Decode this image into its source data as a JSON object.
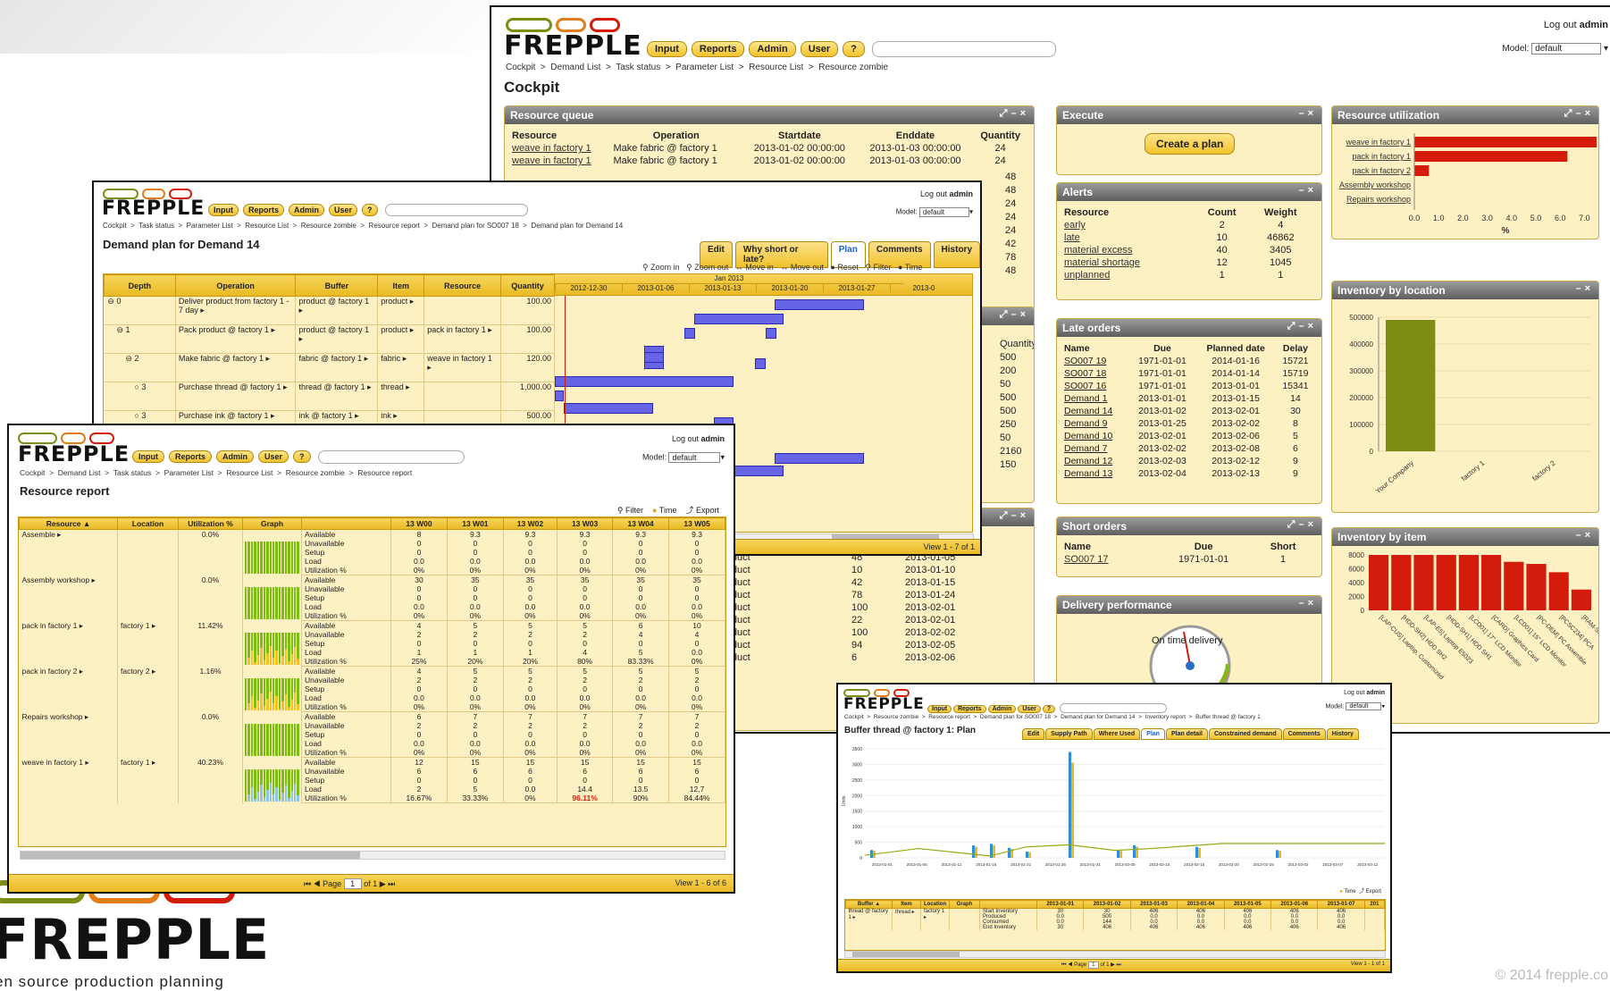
{
  "brand": {
    "name": "FREPPLE",
    "tagline": "en source production planning",
    "copyright": "© 2014 frepple.co"
  },
  "menu": [
    "Input",
    "Reports",
    "Admin",
    "User",
    "?"
  ],
  "colors": {
    "accent": "#f2c22b",
    "bar": "#6565e6",
    "red": "#d41c0c",
    "olive": "#7d8c12",
    "green": "#7dbe12"
  },
  "cockpit": {
    "logout_text": "Log out",
    "user": "admin",
    "model_label": "Model:",
    "model_value": "default",
    "breadcrumbs": "Cockpit  >  Demand List  >  Task status  >  Parameter List  >  Resource List  >  Resource zombie",
    "title": "Cockpit",
    "resource_queue": {
      "title": "Resource queue",
      "headers": [
        "Resource",
        "Operation",
        "Startdate",
        "Enddate",
        "Quantity"
      ],
      "rows": [
        [
          "weave in factory 1",
          "Make fabric @ factory 1",
          "2013-01-02 00:00:00",
          "2013-01-03 00:00:00",
          "24"
        ],
        [
          "weave in factory 1",
          "Make fabric @ factory 1",
          "2013-01-02 00:00:00",
          "2013-01-03 00:00:00",
          "24"
        ]
      ],
      "extra_qty": [
        "48",
        "48",
        "24",
        "24",
        "24",
        "42",
        "78",
        "48"
      ]
    },
    "hidden_widget": {
      "quantity_label": "Quantity",
      "quantities": [
        "500",
        "200",
        "50",
        "500",
        "500",
        "250",
        "50",
        "2160",
        "150"
      ]
    },
    "hidden_orders": {
      "plan_date_label": "Plan date",
      "rows": [
        [
          "product",
          "",
          "2013-01-01"
        ],
        [
          "product",
          "48",
          "2013-01-05"
        ],
        [
          "product",
          "10",
          "2013-01-10"
        ],
        [
          "product",
          "42",
          "2013-01-15"
        ],
        [
          "product",
          "78",
          "2013-01-24"
        ],
        [
          "product",
          "100",
          "2013-02-01"
        ],
        [
          "product",
          "22",
          "2013-02-01"
        ],
        [
          "product",
          "100",
          "2013-02-02"
        ],
        [
          "product",
          "94",
          "2013-02-05"
        ],
        [
          "product",
          "6",
          "2013-02-06"
        ]
      ]
    },
    "execute": {
      "title": "Execute",
      "button": "Create a plan"
    },
    "alerts": {
      "title": "Alerts",
      "headers": [
        "Resource",
        "Count",
        "Weight"
      ],
      "rows": [
        [
          "early",
          "2",
          "4"
        ],
        [
          "late",
          "10",
          "46862"
        ],
        [
          "material excess",
          "40",
          "3405"
        ],
        [
          "material shortage",
          "12",
          "1045"
        ],
        [
          "unplanned",
          "1",
          "1"
        ]
      ]
    },
    "late_orders": {
      "title": "Late orders",
      "headers": [
        "Name",
        "Due",
        "Planned date",
        "Delay"
      ],
      "rows": [
        [
          "SO007 19",
          "1971-01-01",
          "2014-01-16",
          "15721"
        ],
        [
          "SO007 18",
          "1971-01-01",
          "2014-01-14",
          "15719"
        ],
        [
          "SO007 16",
          "1971-01-01",
          "2013-01-01",
          "15341"
        ],
        [
          "Demand 1",
          "2013-01-01",
          "2013-01-15",
          "14"
        ],
        [
          "Demand 14",
          "2013-01-02",
          "2013-02-01",
          "30"
        ],
        [
          "Demand 9",
          "2013-01-25",
          "2013-02-02",
          "8"
        ],
        [
          "Demand 10",
          "2013-02-01",
          "2013-02-06",
          "5"
        ],
        [
          "Demand 7",
          "2013-02-02",
          "2013-02-08",
          "6"
        ],
        [
          "Demand 12",
          "2013-02-03",
          "2013-02-12",
          "9"
        ],
        [
          "Demand 13",
          "2013-02-04",
          "2013-02-13",
          "9"
        ]
      ]
    },
    "short_orders": {
      "title": "Short orders",
      "headers": [
        "Name",
        "Due",
        "Short"
      ],
      "rows": [
        [
          "SO007 17",
          "1971-01-01",
          "1"
        ]
      ]
    },
    "delivery": {
      "title": "Delivery performance",
      "gauge_label": "On time delivery"
    },
    "resource_utilization": {
      "title": "Resource utilization",
      "unit": "%",
      "ticks": [
        "0.0",
        "1.0",
        "2.0",
        "3.0",
        "4.0",
        "5.0",
        "6.0",
        "7.0"
      ]
    },
    "inventory_location": {
      "title": "Inventory by location",
      "ticks": [
        "500000",
        "400000",
        "300000",
        "200000",
        "100000",
        "0"
      ]
    },
    "inventory_item": {
      "title": "Inventory by item",
      "ticks": [
        "8000",
        "6000",
        "4000",
        "2000",
        "0"
      ],
      "labels": [
        "[LAP-CUS] Laptop, Customized",
        "[HDD-SH2] HDD SH2",
        "[LAP-E5] Laptop E5023",
        "[HDD-SH1] HDD SH1",
        "[LCD01] 17\" LCD Monitor",
        "[CARD] Graphics Card",
        "[LCD01] 15\" LCD Monitor",
        "[PC-DEM] PC Assemble",
        "[PCSC234] PCA",
        "[RAM-SR5]"
      ]
    }
  },
  "chart_data": [
    {
      "type": "bar",
      "title": "Resource utilization",
      "categories": [
        "weave in factory 1",
        "pack in factory 1",
        "pack in factory 2",
        "Assembly workshop",
        "Repairs workshop"
      ],
      "values": [
        7.5,
        6.3,
        0.6,
        0,
        0
      ],
      "xlabel": "%",
      "xlim": [
        0,
        7.5
      ]
    },
    {
      "type": "bar",
      "title": "Inventory by location",
      "categories": [
        "Your Company",
        "factory 1",
        "factory 2"
      ],
      "values": [
        490000,
        0,
        0
      ],
      "ylim": [
        0,
        500000
      ]
    },
    {
      "type": "bar",
      "title": "Inventory by item",
      "categories": [
        "[LAP-CUS] Laptop, Customized",
        "[HDD-SH2] HDD SH2",
        "[LAP-E5] Laptop E5023",
        "[HDD-SH1] HDD SH1",
        "[LCD01] 17\" LCD Monitor",
        "[CARD] Graphics Card",
        "[LCD01] 15\" LCD Monitor",
        "[PC-DEM] PC Assemble",
        "[PCSC234] PCA",
        "[RAM-SR5]"
      ],
      "values": [
        8000,
        8000,
        8000,
        8000,
        8000,
        8000,
        7000,
        6700,
        5500,
        3000
      ],
      "ylim": [
        0,
        8000
      ]
    }
  ],
  "demand_plan": {
    "logout_text": "Log out",
    "user": "admin",
    "model_label": "Model:",
    "model_value": "default",
    "breadcrumbs": "Cockpit  >  Task status  >  Parameter List  >  Resource List  >  Resource zombie  >  Resource report  >  Demand plan for SO007 18  >  Demand plan for Demand 14",
    "title": "Demand plan for Demand 14",
    "tabs": [
      "Edit",
      "Why short or late?",
      "Plan",
      "Comments",
      "History"
    ],
    "active_tab": "Plan",
    "tools": [
      "Zoom in",
      "Zoom out",
      "Move in",
      "Move out",
      "Reset",
      "Filter",
      "Time"
    ],
    "headers": [
      "Depth",
      "Operation",
      "Buffer",
      "Item",
      "Resource",
      "Quantity"
    ],
    "month": "Jan 2013",
    "dates": [
      "2012-12-30",
      "2013-01-06",
      "2013-01-13",
      "2013-01-20",
      "2013-01-27",
      "2013-0"
    ],
    "rows": [
      {
        "depth": "0",
        "operation": "Deliver product from factory 1 - 7 day",
        "buffer": "product @ factory 1",
        "item": "product",
        "resource": "",
        "qty": "100.00"
      },
      {
        "depth": "1",
        "operation": "Pack product @ factory 1",
        "buffer": "product @ factory 1",
        "item": "product",
        "resource": "pack in factory 1",
        "qty": "100.00"
      },
      {
        "depth": "2",
        "operation": "Make fabric @ factory 1",
        "buffer": "fabric @ factory 1",
        "item": "fabric",
        "resource": "weave in factory 1",
        "qty": "120.00"
      },
      {
        "depth": "3",
        "operation": "Purchase thread @ factory 1",
        "buffer": "thread @ factory 1",
        "item": "thread",
        "resource": "",
        "qty": "1,000.00"
      },
      {
        "depth": "3",
        "operation": "Purchase ink @ factory 1",
        "buffer": "ink @ factory 1",
        "item": "ink",
        "resource": "",
        "qty": "500.00"
      }
    ],
    "footer": "View 1 - 7 of 1"
  },
  "resource_report": {
    "logout_text": "Log out",
    "user": "admin",
    "model_label": "Model:",
    "model_value": "default",
    "breadcrumbs": "Cockpit  >  Demand List  >  Task status  >  Parameter List  >  Resource List  >  Resource zombie  >  Resource report",
    "title": "Resource report",
    "tools": [
      "Filter",
      "Time",
      "Export"
    ],
    "headers": [
      "Resource ▲",
      "Location",
      "Utilization %",
      "Graph",
      "",
      "13 W00",
      "13 W01",
      "13 W02",
      "13 W03",
      "13 W04",
      "13 W05"
    ],
    "measures": [
      "Available",
      "Unavailable",
      "Setup",
      "Load",
      "Utilization %"
    ],
    "resources": [
      {
        "name": "Assemble",
        "location": "",
        "util": "0.0%",
        "values": [
          [
            "8",
            "9.3",
            "9.3",
            "9.3",
            "9.3",
            "9.3"
          ],
          [
            "0",
            "0",
            "0",
            "0",
            "0",
            "0"
          ],
          [
            "0",
            "0",
            "0",
            "0",
            "0",
            "0"
          ],
          [
            "0.0",
            "0.0",
            "0.0",
            "0.0",
            "0.0",
            "0.0"
          ],
          [
            "0%",
            "0%",
            "0%",
            "0%",
            "0%",
            "0%"
          ]
        ]
      },
      {
        "name": "Assembly workshop",
        "location": "",
        "util": "0.0%",
        "values": [
          [
            "30",
            "35",
            "35",
            "35",
            "35",
            "35"
          ],
          [
            "0",
            "0",
            "0",
            "0",
            "0",
            "0"
          ],
          [
            "0",
            "0",
            "0",
            "0",
            "0",
            "0"
          ],
          [
            "0.0",
            "0.0",
            "0.0",
            "0.0",
            "0.0",
            "0.0"
          ],
          [
            "0%",
            "0%",
            "0%",
            "0%",
            "0%",
            "0%"
          ]
        ]
      },
      {
        "name": "pack in factory 1",
        "location": "factory 1",
        "util": "11.42%",
        "values": [
          [
            "4",
            "5",
            "5",
            "5",
            "6",
            "10"
          ],
          [
            "2",
            "2",
            "2",
            "2",
            "4",
            "4"
          ],
          [
            "0",
            "0",
            "0",
            "0",
            "0",
            "0"
          ],
          [
            "1",
            "1",
            "1",
            "4",
            "5",
            "0.0"
          ],
          [
            "25%",
            "20%",
            "20%",
            "80%",
            "83.33%",
            "0%"
          ]
        ]
      },
      {
        "name": "pack in factory 2",
        "location": "factory 2",
        "util": "1.16%",
        "values": [
          [
            "4",
            "5",
            "5",
            "5",
            "5",
            "5"
          ],
          [
            "2",
            "2",
            "2",
            "2",
            "2",
            "2"
          ],
          [
            "0",
            "0",
            "0",
            "0",
            "0",
            "0"
          ],
          [
            "0.0",
            "0.0",
            "0.0",
            "0.0",
            "0.0",
            "0.0"
          ],
          [
            "0%",
            "0%",
            "0%",
            "0%",
            "0%",
            "0%"
          ]
        ]
      },
      {
        "name": "Repairs workshop",
        "location": "",
        "util": "0.0%",
        "values": [
          [
            "6",
            "7",
            "7",
            "7",
            "7",
            "7"
          ],
          [
            "2",
            "2",
            "2",
            "2",
            "2",
            "2"
          ],
          [
            "0",
            "0",
            "0",
            "0",
            "0",
            "0"
          ],
          [
            "0.0",
            "0.0",
            "0.0",
            "0.0",
            "0.0",
            "0.0"
          ],
          [
            "0%",
            "0%",
            "0%",
            "0%",
            "0%",
            "0%"
          ]
        ]
      },
      {
        "name": "weave in factory 1",
        "location": "factory 1",
        "util": "40.23%",
        "values": [
          [
            "12",
            "15",
            "15",
            "15",
            "15",
            "15"
          ],
          [
            "6",
            "6",
            "6",
            "6",
            "6",
            "6"
          ],
          [
            "0",
            "0",
            "0",
            "0",
            "0",
            "0"
          ],
          [
            "2",
            "5",
            "0.0",
            "14.4",
            "13.5",
            "12.7"
          ],
          [
            "16.67%",
            "33.33%",
            "0%",
            "96.11%",
            "90%",
            "84.44%"
          ]
        ]
      }
    ],
    "page_label": "Page",
    "page": "1",
    "of_label": "of 1",
    "footer": "View 1 - 6 of 6"
  },
  "buffer_plan": {
    "logout_text": "Log out",
    "user": "admin",
    "model_label": "Model:",
    "model_value": "default",
    "breadcrumbs": "Cockpit  >  Resource zombie  >  Resource report  >  Demand plan for SO007 18  >  Demand plan for Demand 14  >  Inventory report  >  Buffer thread @ factory 1",
    "title": "Buffer thread @ factory 1: Plan",
    "tabs": [
      "Edit",
      "Supply Path",
      "Where Used",
      "Plan",
      "Plan detail",
      "Constrained demand",
      "Comments",
      "History"
    ],
    "active_tab": "Plan",
    "yticks": [
      "3500",
      "3000",
      "2500",
      "2000",
      "1500",
      "1000",
      "500",
      "0"
    ],
    "ylabel": "Units",
    "xdates": [
      "2013-01-01",
      "2013-01-06",
      "2013-01-11",
      "2013-01-16",
      "2013-01-21",
      "2013-01-26",
      "2013-01-31",
      "2013-02-05",
      "2013-02-10",
      "2013-02-15",
      "2013-02-20",
      "2013-02-25",
      "2013-03-02",
      "2013-03-07",
      "2013-03-12"
    ],
    "legend": [
      "Time",
      "Export"
    ],
    "headers": [
      "Buffer ▲",
      "Item",
      "Location",
      "Graph",
      "",
      "2013-01-01",
      "2013-01-02",
      "2013-01-03",
      "2013-01-04",
      "2013-01-05",
      "2013-01-06",
      "2013-01-07",
      "201"
    ],
    "row": {
      "buffer": "thread @ factory 1",
      "item": "thread",
      "location": "factory 1"
    },
    "measures": [
      "Start Inventory",
      "Produced",
      "Consumed",
      "End Inventory"
    ],
    "values": [
      [
        "30",
        "30",
        "406",
        "406",
        "406",
        "406",
        "406"
      ],
      [
        "0.0",
        "500",
        "0.0",
        "0.0",
        "0.0",
        "0.0",
        "0.0"
      ],
      [
        "0.0",
        "144",
        "0.0",
        "0.0",
        "0.0",
        "0.0",
        "0.0"
      ],
      [
        "30",
        "406",
        "406",
        "406",
        "406",
        "406",
        "406"
      ]
    ],
    "page_label": "Page",
    "page": "1",
    "of_label": "of 1",
    "footer": "View 1 - 1 of 1"
  }
}
